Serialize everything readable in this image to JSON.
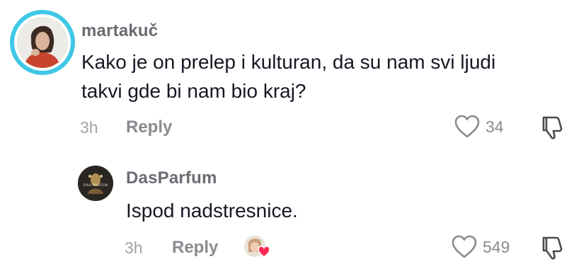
{
  "comment": {
    "username": "martakuč",
    "text_line1": "Kako je on prelep i kulturan, da su nam svi ljudi",
    "text_line2": "takvi gde bi nam bio kraj?",
    "time": "3h",
    "reply_label": "Reply",
    "like_count": "34"
  },
  "reply": {
    "username": "DasParfum",
    "avatar_text": "DAS PARFUM",
    "text": "Ispod nadstresnice.",
    "time": "3h",
    "reply_label": "Reply",
    "like_count": "549"
  },
  "colors": {
    "story_ring": "#3fc8e6",
    "liked_by_heart": "#fe2c55",
    "muted_text": "#8a8a90"
  }
}
